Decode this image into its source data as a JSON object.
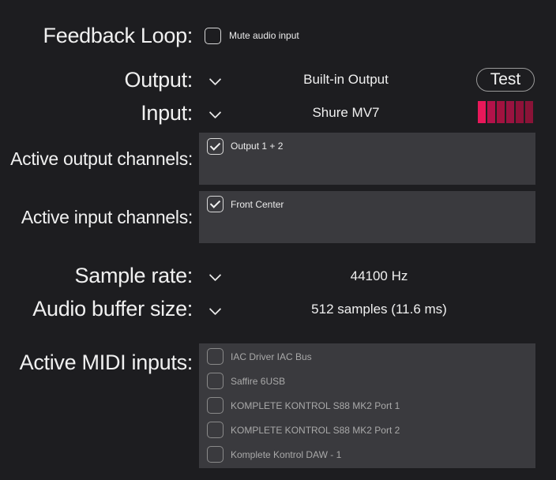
{
  "feedback_loop": {
    "label": "Feedback Loop:",
    "checkbox_label": "Mute audio input",
    "checked": false
  },
  "output": {
    "label": "Output:",
    "value": "Built-in Output",
    "test_label": "Test"
  },
  "input": {
    "label": "Input:",
    "value": "Shure MV7",
    "meter_level": 1.0,
    "meter_colors": [
      "#e8185a",
      "#b3124a",
      "#a2123f",
      "#9a1340",
      "#8f1239",
      "#8a1337"
    ]
  },
  "active_output_channels": {
    "label": "Active output channels:",
    "items": [
      {
        "label": "Output 1 + 2",
        "checked": true
      }
    ]
  },
  "active_input_channels": {
    "label": "Active input channels:",
    "items": [
      {
        "label": "Front Center",
        "checked": true
      }
    ]
  },
  "sample_rate": {
    "label": "Sample rate:",
    "value": "44100 Hz"
  },
  "buffer_size": {
    "label": "Audio buffer size:",
    "value": "512 samples (11.6 ms)"
  },
  "midi_inputs": {
    "label": "Active MIDI inputs:",
    "items": [
      {
        "label": "IAC Driver IAC Bus",
        "checked": false
      },
      {
        "label": "Saffire 6USB",
        "checked": false
      },
      {
        "label": "KOMPLETE KONTROL S88 MK2 Port 1",
        "checked": false
      },
      {
        "label": "KOMPLETE KONTROL S88 MK2 Port 2",
        "checked": false
      },
      {
        "label": "Komplete Kontrol DAW - 1",
        "checked": false
      }
    ]
  }
}
